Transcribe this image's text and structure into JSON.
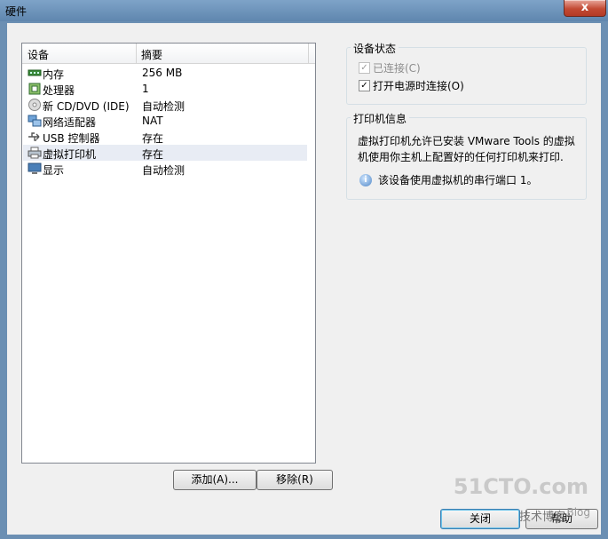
{
  "window": {
    "title": "硬件",
    "close_symbol": "x"
  },
  "hardware_list": {
    "headers": {
      "device": "设备",
      "summary": "摘要"
    },
    "rows": [
      {
        "device": "内存",
        "summary": "256 MB",
        "icon": "memory-icon"
      },
      {
        "device": "处理器",
        "summary": "1",
        "icon": "processor-icon"
      },
      {
        "device": "新 CD/DVD (IDE)",
        "summary": "自动检测",
        "icon": "cd-dvd-icon"
      },
      {
        "device": "网络适配器",
        "summary": "NAT",
        "icon": "network-adapter-icon"
      },
      {
        "device": "USB 控制器",
        "summary": "存在",
        "icon": "usb-icon"
      },
      {
        "device": "虚拟打印机",
        "summary": "存在",
        "icon": "printer-icon"
      },
      {
        "device": "显示",
        "summary": "自动检测",
        "icon": "display-icon"
      }
    ],
    "selected_index": 5
  },
  "buttons": {
    "add": "添加(A)...",
    "remove": "移除(R)",
    "close": "关闭",
    "help": "帮助"
  },
  "device_status": {
    "title": "设备状态",
    "connected": {
      "label": "已连接(C)",
      "checked": true,
      "disabled": true
    },
    "connect_at_power_on": {
      "label": "打开电源时连接(O)",
      "checked": true,
      "disabled": false
    }
  },
  "printer_info": {
    "title": "打印机信息",
    "line1": "虚拟打印机允许已安装 VMware Tools 的虚拟",
    "line2": "机使用你主机上配置好的任何打印机来打印.",
    "note": "该设备使用虚拟机的串行端口 1。"
  },
  "watermark": {
    "site": "51CTO.com",
    "subtitle": "技术博客",
    "tag": "Blog"
  },
  "colors": {
    "selection": "#e8ecf4",
    "titlebar": "#6f95bc",
    "close": "#c24a34"
  }
}
